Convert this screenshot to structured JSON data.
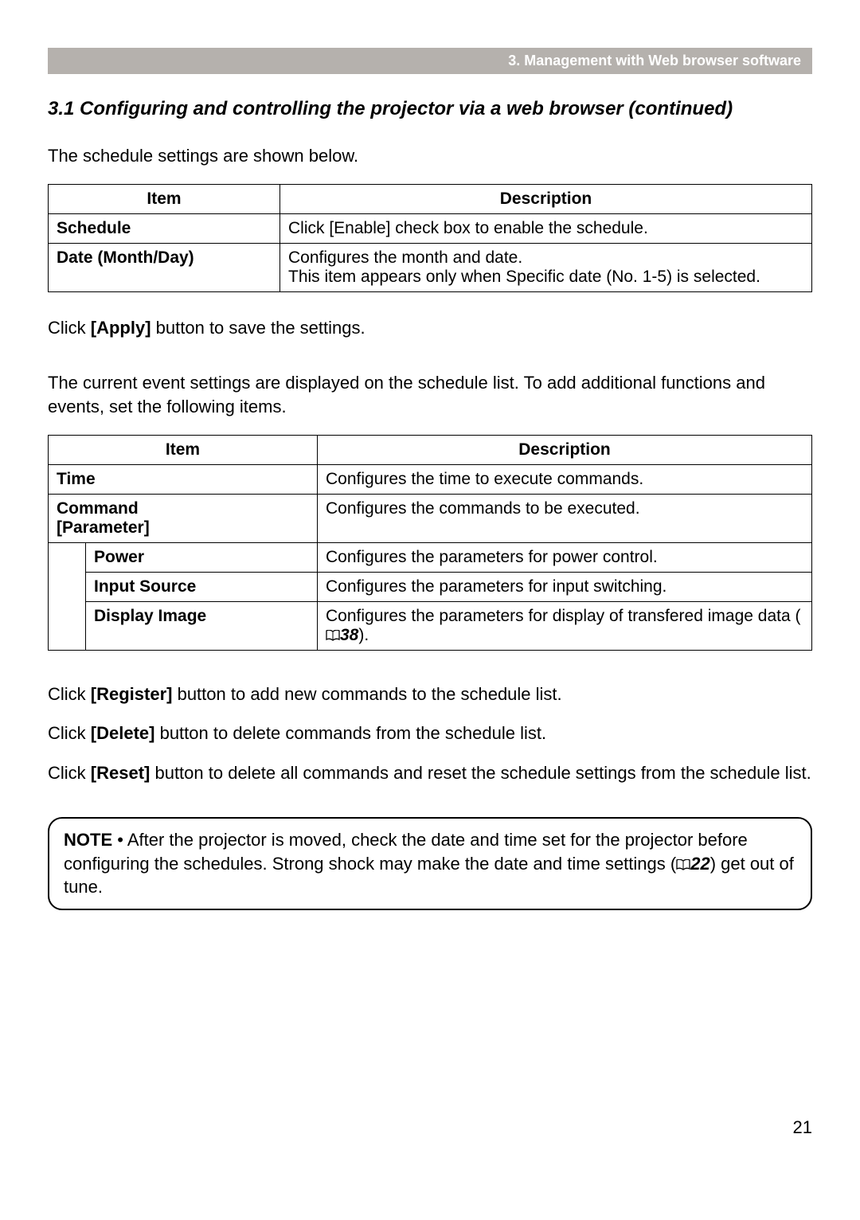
{
  "chapter_bar": "3. Management with Web browser software",
  "section_title": "3.1 Configuring and controlling the projector via a web browser (continued)",
  "intro_text": "The schedule settings are shown below.",
  "table1": {
    "headers": [
      "Item",
      "Description"
    ],
    "rows": [
      {
        "item": "Schedule",
        "desc_parts": [
          "Click ",
          "[Enable]",
          " check box to enable the schedule."
        ]
      },
      {
        "item": "Date (Month/Day)",
        "desc": "Configures the month and date.\nThis item appears only when Specific date (No. 1-5) is selected."
      }
    ]
  },
  "apply_text_parts": [
    "Click ",
    "[Apply]",
    " button to save the settings."
  ],
  "mid_text": "The current event settings are displayed on the schedule list. To add additional functions and events, set the following items.",
  "table2": {
    "headers": [
      "Item",
      "Description"
    ],
    "rows": [
      {
        "item": "Time",
        "desc": "Configures the time to execute commands."
      },
      {
        "item": "Command\n[Parameter]",
        "desc": "Configures the commands to be executed."
      },
      {
        "item": "Power",
        "desc": "Configures the parameters for power control.",
        "indent": true
      },
      {
        "item": "Input Source",
        "desc": "Configures the parameters for input switching.",
        "indent": true
      },
      {
        "item": "Display Image",
        "desc_pre": "Configures the parameters for display of transfered image data (",
        "ref": "38",
        "desc_post": ").",
        "indent": true
      }
    ]
  },
  "register_parts": [
    "Click ",
    "[Register]",
    " button to add new commands to the schedule list."
  ],
  "delete_parts": [
    "Click ",
    "[Delete]",
    " button to delete commands from the schedule list."
  ],
  "reset_parts": [
    "Click ",
    "[Reset]",
    " button to delete all commands and reset the schedule settings from the schedule list."
  ],
  "note": {
    "label": "NOTE",
    "pre": "  • After the projector is moved, check the date and time set for the projector before configuring the schedules. Strong shock may make the date and time settings (",
    "ref": "22",
    "post": ") get out of tune."
  },
  "page_number": "21"
}
